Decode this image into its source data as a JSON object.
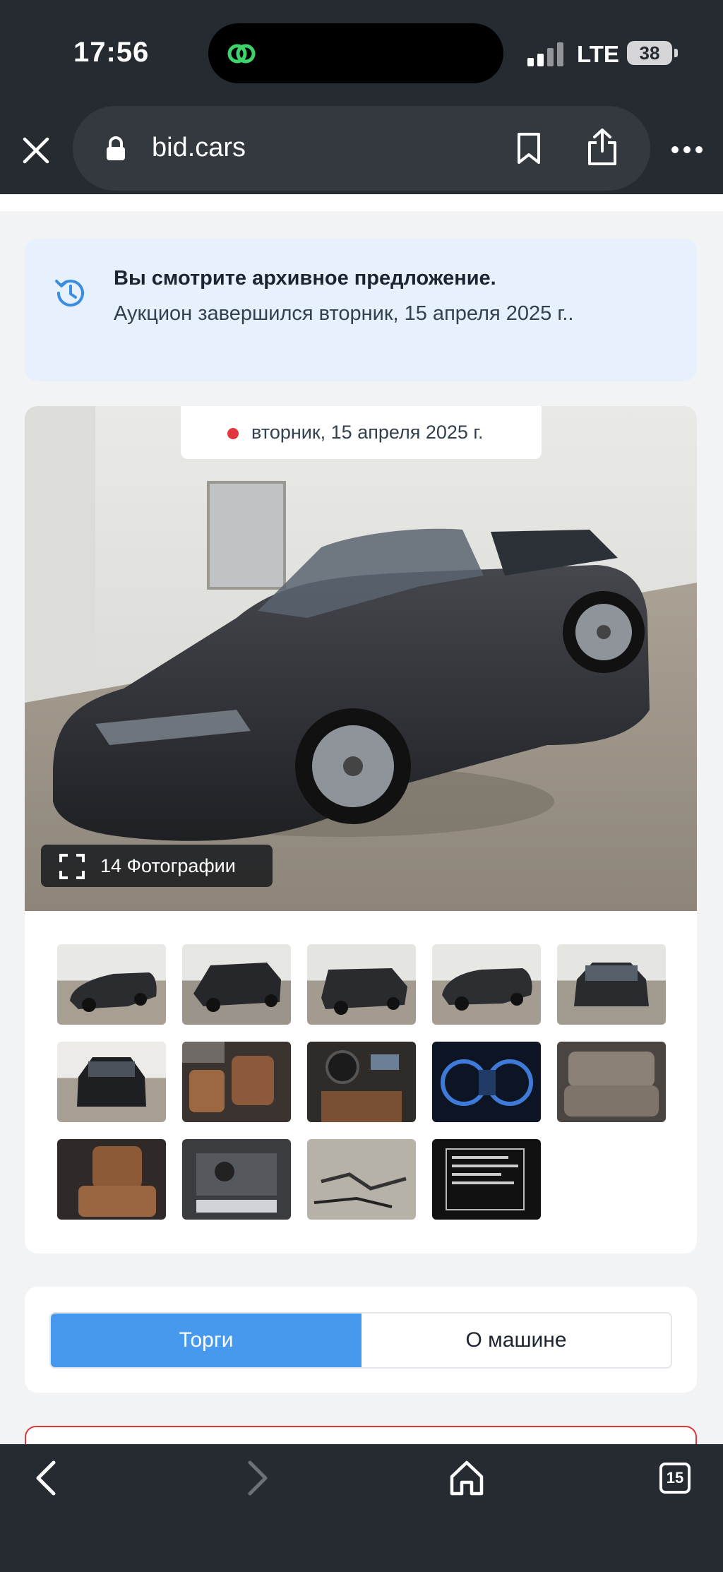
{
  "status_bar": {
    "time": "17:56",
    "network": "LTE",
    "battery": "38"
  },
  "browser": {
    "url": "bid.cars",
    "icons": [
      "close-icon",
      "lock-icon",
      "bookmark-icon",
      "share-icon",
      "more-icon"
    ]
  },
  "notice": {
    "title": "Вы смотрите архивное предложение.",
    "text": "Аукцион завершился вторник, 15 апреля 2025 г.."
  },
  "gallery": {
    "date_label": "вторник, 15 апреля 2025 г.",
    "photo_count_label": "14 Фотографии",
    "thumbnails": [
      "front-left",
      "rear-left",
      "rear-damage",
      "left-side",
      "front",
      "rear",
      "front-seats",
      "dashboard",
      "instrument-cluster",
      "rear-seats",
      "rear-seat-side",
      "engine-bay",
      "parts-on-floor",
      "vin-label"
    ]
  },
  "tabs": {
    "active": "Торги",
    "other": "О машине"
  },
  "bottom_bar": {
    "tab_count": "15"
  },
  "colors": {
    "accent": "#4799ee",
    "alert_red": "#e1353a",
    "notice_bg": "#e7f1fd",
    "chrome": "#262a31"
  }
}
